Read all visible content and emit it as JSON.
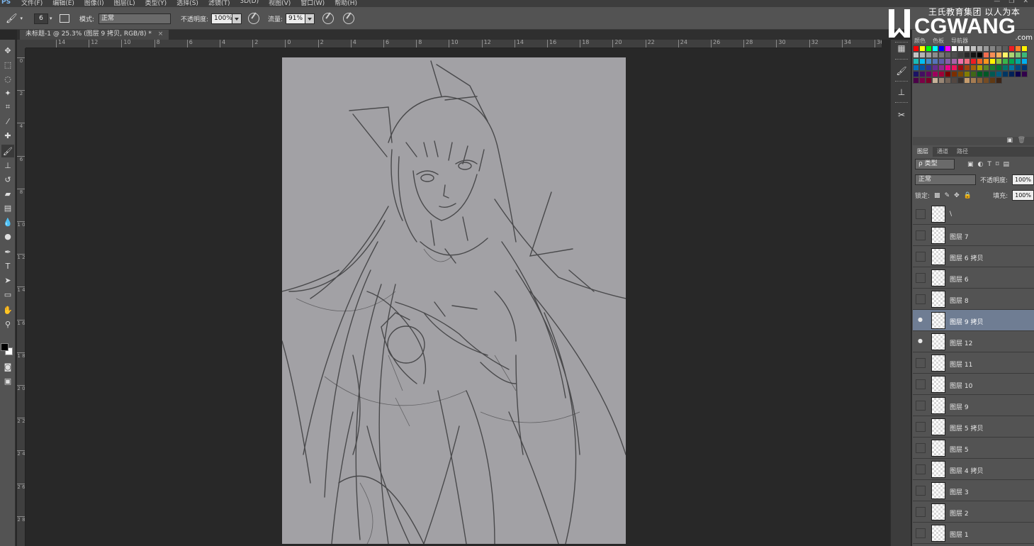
{
  "app": {
    "logo_text": "PS",
    "menu": [
      "文件(F)",
      "编辑(E)",
      "图像(I)",
      "图层(L)",
      "类型(Y)",
      "选择(S)",
      "滤镜(T)",
      "3D(D)",
      "视图(V)",
      "窗口(W)",
      "帮助(H)"
    ]
  },
  "options_bar": {
    "brush_size": "6",
    "mode_label": "模式:",
    "mode_value": "正常",
    "opacity_label": "不透明度:",
    "opacity_value": "100%",
    "flow_label": "流量:",
    "flow_value": "91%"
  },
  "document": {
    "tab_title": "未标题-1 @ 25.3% (图层 9 拷贝, RGB/8) *",
    "close": "×"
  },
  "rulers": {
    "horizontal": [
      "14",
      "12",
      "10",
      "8",
      "6",
      "4",
      "2",
      "0",
      "2",
      "4",
      "6",
      "8",
      "10",
      "12",
      "14",
      "16",
      "18",
      "20",
      "22",
      "24",
      "26",
      "28",
      "30",
      "32",
      "34",
      "36"
    ],
    "vertical": [
      "0",
      "2",
      "4",
      "6",
      "8",
      "1 0",
      "1 2",
      "1 4",
      "1 6",
      "1 8",
      "2 0",
      "2 2",
      "2 4",
      "2 6",
      "2 8"
    ]
  },
  "watermark": {
    "cn": "王氏教育集团 以人为本",
    "brand": "CGWANG",
    "domain": ".com"
  },
  "swatches_panel": {
    "tabs": [
      "颜色",
      "色板",
      "导航器"
    ]
  },
  "layers_panel": {
    "tabs": [
      "图层",
      "通道",
      "路径"
    ],
    "kind_label": "ρ 类型",
    "blend_mode": "正常",
    "opacity_label": "不透明度:",
    "opacity_value": "100%",
    "lock_label": "锁定:",
    "fill_label": "填充:",
    "fill_value": "100%",
    "layers": [
      {
        "name": "\\",
        "visible": false,
        "selected": false
      },
      {
        "name": "图层 7",
        "visible": false,
        "selected": false
      },
      {
        "name": "图层 6 拷贝",
        "visible": false,
        "selected": false
      },
      {
        "name": "图层 6",
        "visible": false,
        "selected": false
      },
      {
        "name": "图层 8",
        "visible": false,
        "selected": false
      },
      {
        "name": "图层 9 拷贝",
        "visible": true,
        "selected": true
      },
      {
        "name": "图层 12",
        "visible": true,
        "selected": false
      },
      {
        "name": "图层 11",
        "visible": false,
        "selected": false
      },
      {
        "name": "图层 10",
        "visible": false,
        "selected": false
      },
      {
        "name": "图层 9",
        "visible": false,
        "selected": false
      },
      {
        "name": "图层 5 拷贝",
        "visible": false,
        "selected": false
      },
      {
        "name": "图层 5",
        "visible": false,
        "selected": false
      },
      {
        "name": "图层 4 拷贝",
        "visible": false,
        "selected": false
      },
      {
        "name": "图层 3",
        "visible": false,
        "selected": false
      },
      {
        "name": "图层 2",
        "visible": false,
        "selected": false
      },
      {
        "name": "图层 1",
        "visible": false,
        "selected": false
      }
    ]
  },
  "colors": {
    "canvas_bg": "#a2a1a5",
    "selected_layer": "#6f7d93",
    "workspace": "#282828"
  }
}
